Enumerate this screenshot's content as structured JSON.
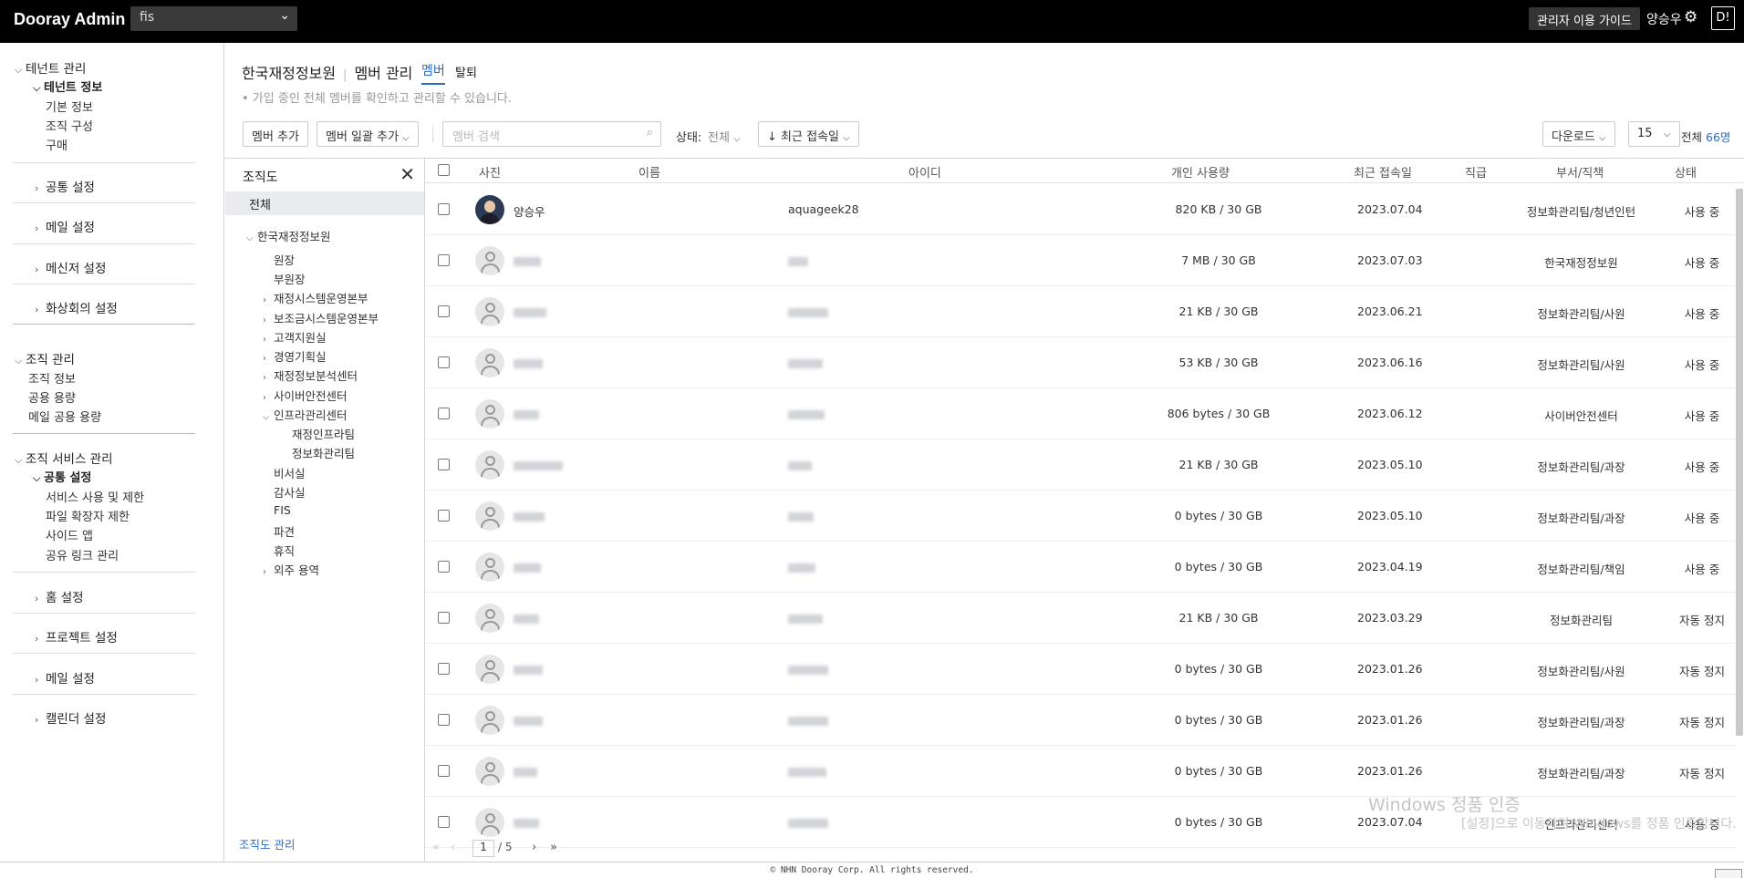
{
  "topbar": {
    "brand": "Dooray Admin",
    "tenant_value": "fis",
    "guide_label": "관리자 이용 가이드",
    "username": "양승우",
    "d_label": "D!"
  },
  "leftnav": {
    "tenant_mgmt": "테넌트 관리",
    "tenant_info": "테넌트 정보",
    "basic_info": "기본 정보",
    "org_structure": "조직 구성",
    "purchase": "구매",
    "common_settings": "공통 설정",
    "mail_settings": "메일 설정",
    "messenger_settings": "메신저 설정",
    "videoconf_settings": "화상회의 설정",
    "org_mgmt": "조직 관리",
    "org_info": "조직 정보",
    "shared_capacity": "공용 용량",
    "mail_shared_capacity": "메일 공용 용량",
    "org_service_mgmt": "조직 서비스 관리",
    "svc_common_settings": "공통 설정",
    "service_usage": "서비스 사용 및 제한",
    "file_ext_limit": "파일 확장자 제한",
    "side_app": "사이드 앱",
    "shared_link": "공유 링크 관리",
    "home_settings": "홈 설정",
    "project_settings": "프로젝트 설정",
    "mail_settings2": "메일 설정",
    "calendar_settings": "캘린더 설정"
  },
  "header": {
    "org_name": "한국재정정보원",
    "section": "멤버 관리",
    "tab_member": "멤버",
    "tab_withdraw": "탈퇴",
    "subtitle": "• 가입 중인 전체 멤버를 확인하고 관리할 수 있습니다."
  },
  "toolbar": {
    "add_member": "멤버 추가",
    "bulk_add": "멤버 일괄 추가",
    "search_placeholder": "멤버 검색",
    "status_label": "상태:",
    "status_value": "전체",
    "sort_label": "최근 접속일",
    "download": "다운로드",
    "page_size": "15",
    "total_prefix": "전체",
    "total_count": "66명"
  },
  "org_panel": {
    "title": "조직도",
    "all": "전체",
    "root": "한국재정정보원",
    "nodes": [
      "원장",
      "부원장",
      "재정시스템운영본부",
      "보조금시스템운영본부",
      "고객지원실",
      "경영기획실",
      "재정정보분석센터",
      "사이버안전센터",
      "인프라관리센터",
      "재정인프라팀",
      "정보화관리팀",
      "비서실",
      "감사실",
      "FIS",
      "파견",
      "휴직",
      "외주 용역"
    ],
    "manage": "조직도 관리"
  },
  "table": {
    "headers": [
      "사진",
      "이름",
      "아이디",
      "개인 사용량",
      "최근 접속일",
      "직급",
      "부서/직책",
      "상태"
    ],
    "rows": [
      {
        "name": "양승우",
        "id": "aquageek28",
        "usage": "820 KB / 30 GB",
        "date": "2023.07.04",
        "dept": "정보화관리팀/청년인턴",
        "status": "사용 중",
        "photo": true
      },
      {
        "name": "",
        "id": "",
        "usage": "7 MB / 30 GB",
        "date": "2023.07.03",
        "dept": "한국재정정보원",
        "status": "사용 중"
      },
      {
        "name": "",
        "id": "",
        "usage": "21 KB / 30 GB",
        "date": "2023.06.21",
        "dept": "정보화관리팀/사원",
        "status": "사용 중"
      },
      {
        "name": "",
        "id": "",
        "usage": "53 KB / 30 GB",
        "date": "2023.06.16",
        "dept": "정보화관리팀/사원",
        "status": "사용 중"
      },
      {
        "name": "",
        "id": "",
        "usage": "806 bytes / 30 GB",
        "date": "2023.06.12",
        "dept": "사이버안전센터",
        "status": "사용 중"
      },
      {
        "name": "",
        "id": "",
        "usage": "21 KB / 30 GB",
        "date": "2023.05.10",
        "dept": "정보화관리팀/과장",
        "status": "사용 중"
      },
      {
        "name": "",
        "id": "",
        "usage": "0 bytes / 30 GB",
        "date": "2023.05.10",
        "dept": "정보화관리팀/과장",
        "status": "사용 중"
      },
      {
        "name": "",
        "id": "",
        "usage": "0 bytes / 30 GB",
        "date": "2023.04.19",
        "dept": "정보화관리팀/책임",
        "status": "사용 중"
      },
      {
        "name": "",
        "id": "",
        "usage": "21 KB / 30 GB",
        "date": "2023.03.29",
        "dept": "정보화관리팀",
        "status": "자동 정지"
      },
      {
        "name": "",
        "id": "",
        "usage": "0 bytes / 30 GB",
        "date": "2023.01.26",
        "dept": "정보화관리팀/사원",
        "status": "자동 정지"
      },
      {
        "name": "",
        "id": "",
        "usage": "0 bytes / 30 GB",
        "date": "2023.01.26",
        "dept": "정보화관리팀/과장",
        "status": "자동 정지"
      },
      {
        "name": "",
        "id": "",
        "usage": "0 bytes / 30 GB",
        "date": "2023.01.26",
        "dept": "정보화관리팀/과장",
        "status": "자동 정지"
      },
      {
        "name": "",
        "id": "",
        "usage": "0 bytes / 30 GB",
        "date": "2023.07.04",
        "dept": "인프라관리센터",
        "status": "사용 중"
      }
    ]
  },
  "pager": {
    "current": "1",
    "total": "/ 5"
  },
  "watermark": {
    "line1": "Windows 정품 인증",
    "line2": "[설정]으로 이동하여 Windows를 정품 인증합니다."
  },
  "footer": "© NHN Dooray Corp. All rights reserved."
}
